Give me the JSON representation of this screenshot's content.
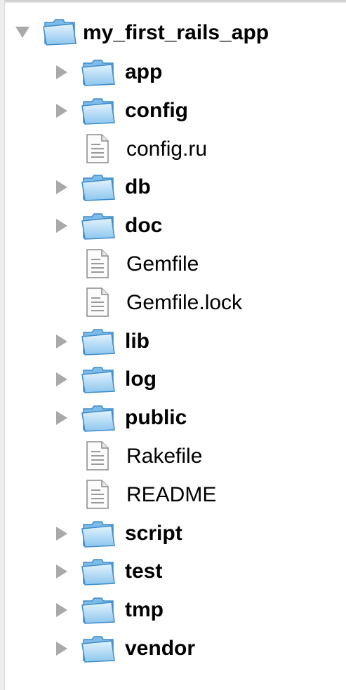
{
  "tree": {
    "root": {
      "name": "my_first_rails_app",
      "icon": "folder-icon",
      "expanded": true
    },
    "items": [
      {
        "name": "app",
        "type": "folder",
        "icon": "folder-icon",
        "expanded": false
      },
      {
        "name": "config",
        "type": "folder",
        "icon": "folder-icon",
        "expanded": false
      },
      {
        "name": "config.ru",
        "type": "file",
        "icon": "document-icon"
      },
      {
        "name": "db",
        "type": "folder",
        "icon": "folder-icon",
        "expanded": false
      },
      {
        "name": "doc",
        "type": "folder",
        "icon": "folder-icon",
        "expanded": false
      },
      {
        "name": "Gemfile",
        "type": "file",
        "icon": "document-icon"
      },
      {
        "name": "Gemfile.lock",
        "type": "file",
        "icon": "document-icon"
      },
      {
        "name": "lib",
        "type": "folder",
        "icon": "folder-icon",
        "expanded": false
      },
      {
        "name": "log",
        "type": "folder",
        "icon": "folder-icon",
        "expanded": false
      },
      {
        "name": "public",
        "type": "folder",
        "icon": "folder-icon",
        "expanded": false
      },
      {
        "name": "Rakefile",
        "type": "file",
        "icon": "document-icon"
      },
      {
        "name": "README",
        "type": "file",
        "icon": "document-icon"
      },
      {
        "name": "script",
        "type": "folder",
        "icon": "folder-icon",
        "expanded": false
      },
      {
        "name": "test",
        "type": "folder",
        "icon": "folder-icon",
        "expanded": false
      },
      {
        "name": "tmp",
        "type": "folder",
        "icon": "folder-icon",
        "expanded": false
      },
      {
        "name": "vendor",
        "type": "folder",
        "icon": "folder-icon",
        "expanded": false
      }
    ]
  },
  "colors": {
    "folder_light": "#d6ecfb",
    "folder_dark": "#6fb3e4",
    "folder_edge": "#3f8cc9",
    "disclosure": "#a9a9a9",
    "file_line": "#8a8a8a"
  }
}
